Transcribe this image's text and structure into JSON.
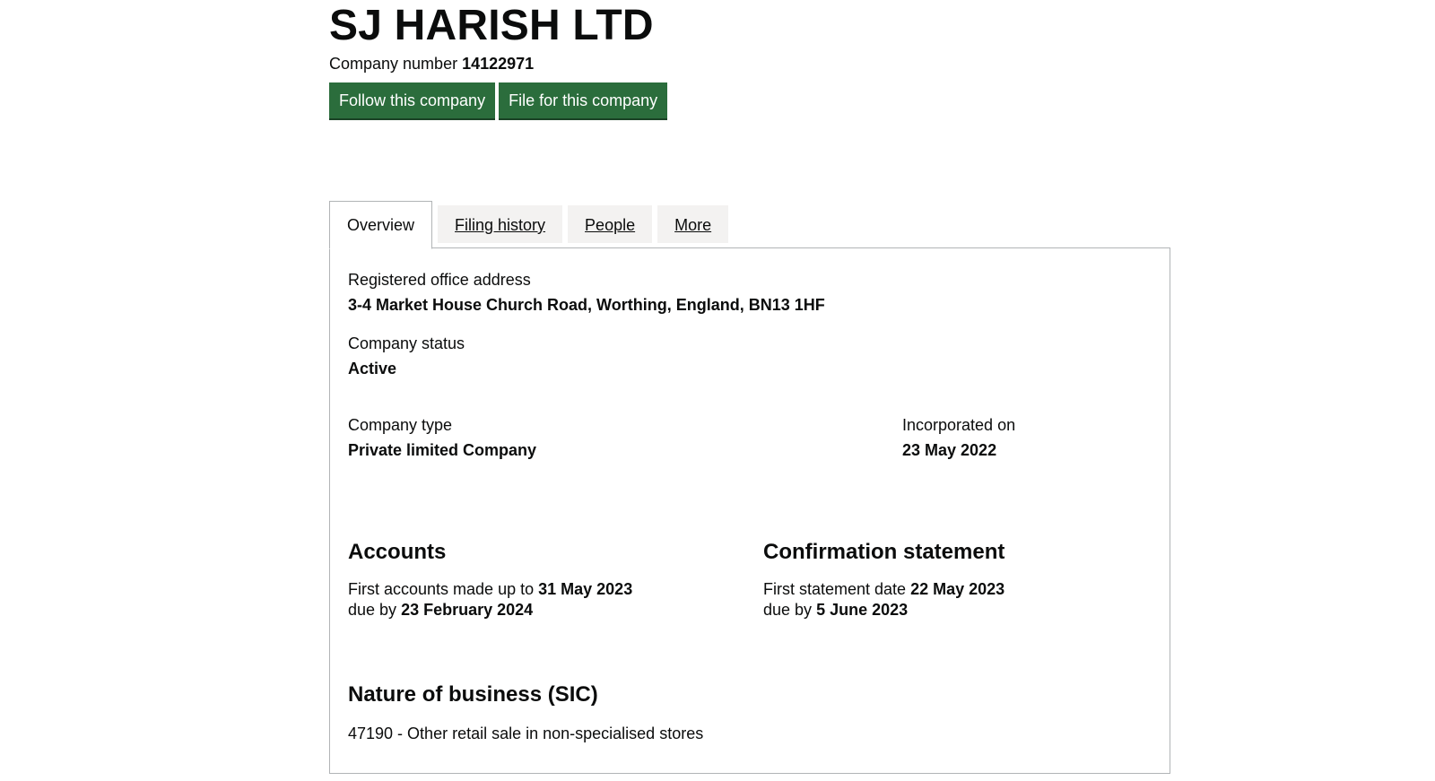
{
  "company": {
    "name": "SJ HARISH LTD",
    "number_label": "Company number",
    "number": "14122971"
  },
  "actions": {
    "follow_label": "Follow this company",
    "file_label": "File for this company"
  },
  "tabs": [
    {
      "label": "Overview",
      "active": true
    },
    {
      "label": "Filing history",
      "active": false
    },
    {
      "label": "People",
      "active": false
    },
    {
      "label": "More",
      "active": false
    }
  ],
  "overview": {
    "registered_office": {
      "label": "Registered office address",
      "value": "3-4 Market House Church Road, Worthing, England, BN13 1HF"
    },
    "status": {
      "label": "Company status",
      "value": "Active"
    },
    "type": {
      "label": "Company type",
      "value": "Private limited Company"
    },
    "incorporated": {
      "label": "Incorporated on",
      "value": "23 May 2022"
    },
    "accounts": {
      "heading": "Accounts",
      "line1_prefix": "First accounts made up to",
      "line1_value": "31 May 2023",
      "line2_prefix": "due by",
      "line2_value": "23 February 2024"
    },
    "confirmation": {
      "heading": "Confirmation statement",
      "line1_prefix": "First statement date",
      "line1_value": "22 May 2023",
      "line2_prefix": "due by",
      "line2_value": "5 June 2023"
    },
    "sic": {
      "heading": "Nature of business (SIC)",
      "items": [
        "47190 - Other retail sale in non-specialised stores"
      ]
    }
  },
  "colors": {
    "button_green": "#2b6d3c",
    "tab_inactive_bg": "#f3f2f1",
    "border": "#b1b4b6",
    "text": "#0b0c0c"
  }
}
